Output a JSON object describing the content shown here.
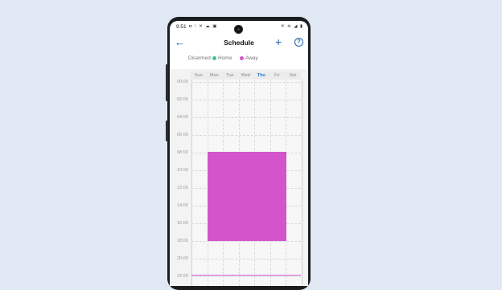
{
  "status_bar": {
    "time": "9:51",
    "left_icons": "◘ ⁝ ✕ ☁ ▣",
    "right_icons": "✕ ≋ ◢ ▮"
  },
  "header": {
    "back_icon": "←",
    "title": "Schedule",
    "add_icon": "+",
    "help_icon": "?"
  },
  "legend": [
    {
      "label": "Disarmed",
      "color": "#ffffff"
    },
    {
      "label": "Home",
      "color": "#3cc58a"
    },
    {
      "label": "Away",
      "color": "#d454cc"
    }
  ],
  "days": [
    "Sun",
    "Mon",
    "Tue",
    "Wed",
    "Thu",
    "Fri",
    "Sat"
  ],
  "active_day": "Thu",
  "times": [
    "00:00",
    "02:00",
    "04:00",
    "06:00",
    "08:00",
    "10:00",
    "12:00",
    "14:00",
    "16:00",
    "18:00",
    "20:00",
    "22:00"
  ],
  "colors": {
    "accent": "#1e5fa8",
    "away": "#d454cc",
    "home": "#3cc58a"
  }
}
